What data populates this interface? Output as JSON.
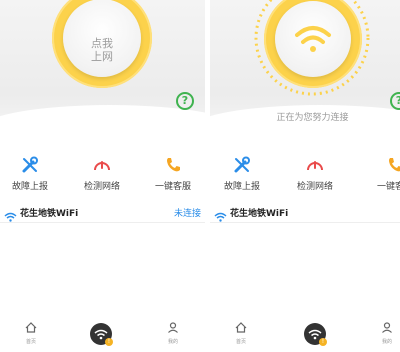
{
  "left_screen": {
    "connect_button": {
      "line1": "点我",
      "line2": "上网"
    },
    "help_icon": "?",
    "tools": [
      {
        "label": "故障上报",
        "icon": "wrench-icon"
      },
      {
        "label": "检测网络",
        "icon": "speedometer-icon"
      },
      {
        "label": "一键客服",
        "icon": "phone-icon"
      }
    ],
    "wifi": {
      "name": "花生地铁WiFi",
      "status": "未连接"
    },
    "nav": [
      {
        "label": "首页",
        "icon": "home-icon"
      },
      {
        "label": "",
        "icon": "wifi-icon"
      },
      {
        "label": "我的",
        "icon": "user-icon"
      }
    ],
    "fab_badge": "!"
  },
  "right_screen": {
    "status_text": "正在为您努力连接",
    "help_icon": "?",
    "tools": [
      {
        "label": "故障上报",
        "icon": "wrench-icon"
      },
      {
        "label": "检测网络",
        "icon": "speedometer-icon"
      },
      {
        "label": "一键客服",
        "icon": "phone-icon"
      }
    ],
    "wifi": {
      "name": "花生地铁WiFi",
      "status": "未连"
    },
    "nav": [
      {
        "label": "首页",
        "icon": "home-icon"
      },
      {
        "label": "",
        "icon": "wifi-icon"
      },
      {
        "label": "我的",
        "icon": "user-icon"
      }
    ],
    "fab_badge": "!"
  },
  "colors": {
    "accent_yellow": "#fcd24b",
    "link_blue": "#2b8de8",
    "help_green": "#3fb34f",
    "wrench_blue": "#2b8de8",
    "gauge_red": "#e94b4b",
    "phone_orange": "#f5a623"
  }
}
